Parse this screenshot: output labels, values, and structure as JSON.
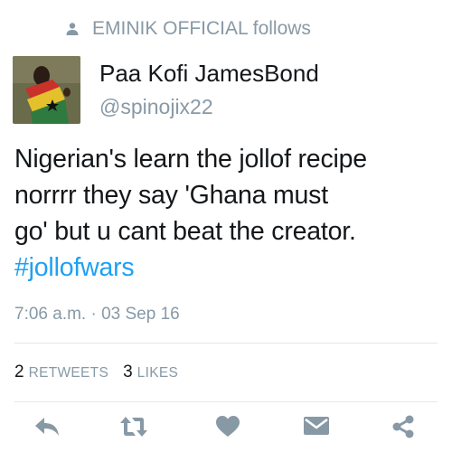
{
  "social_context": {
    "text": "EMINIK OFFICIAL follows",
    "icon": "person-icon"
  },
  "author": {
    "display_name": "Paa Kofi JamesBond",
    "handle": "@spinojix22"
  },
  "tweet": {
    "lines": [
      "Nigerian's learn the jollof recipe",
      "norrrr they say 'Ghana must",
      "go' but u cant beat the creator."
    ],
    "hashtag": "#jollofwars",
    "timestamp": "7:06 a.m. · 03 Sep 16"
  },
  "stats": {
    "retweets_count": "2",
    "retweets_label": "RETWEETS",
    "likes_count": "3",
    "likes_label": "LIKES"
  },
  "actions": {
    "icons": [
      "reply-icon",
      "retweet-icon",
      "like-icon",
      "message-icon",
      "share-icon"
    ],
    "icon_color": "#8899a6"
  },
  "colors": {
    "accent": "#1da1f2",
    "muted": "#8899a6",
    "text": "#14171a",
    "divider": "#e1e8ed"
  }
}
